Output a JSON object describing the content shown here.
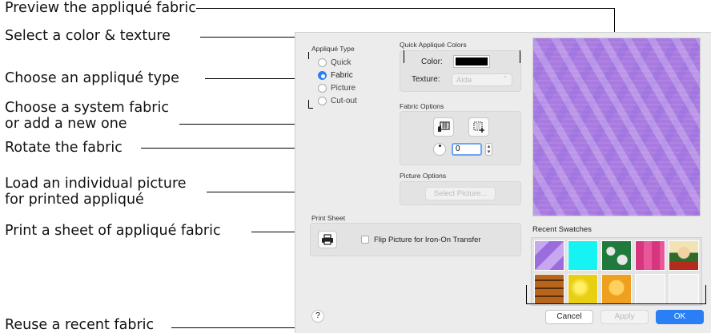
{
  "callouts": [
    "Preview the appliqué fabric",
    "Select a color & texture",
    "Choose an appliqué type",
    "Choose a system fabric",
    "or add a new one",
    "Rotate the fabric",
    "Load an individual picture",
    "for printed appliqué",
    "Print a sheet of appliqué fabric",
    "Reuse a recent fabric"
  ],
  "dialog": {
    "applique_type": {
      "title": "Appliqué Type",
      "options": [
        "Quick",
        "Fabric",
        "Picture",
        "Cut-out"
      ],
      "selected": "Fabric"
    },
    "quick_colors": {
      "title": "Quick Appliqué Colors",
      "color_label": "Color:",
      "color_value": "#000000",
      "texture_label": "Texture:",
      "texture_value": "Aida"
    },
    "fabric_options": {
      "title": "Fabric Options",
      "rotation_value": "0"
    },
    "picture_options": {
      "title": "Picture Options",
      "select_button": "Select Picture..."
    },
    "print_sheet": {
      "title": "Print Sheet",
      "flip_label": "Flip Picture for Iron-On Transfer",
      "flip_checked": false
    },
    "recent_swatches": {
      "title": "Recent Swatches",
      "swatches": [
        "purple-diamond",
        "cyan",
        "green-pattern",
        "pink-pattern",
        "character",
        "brown-brick",
        "yellow-texture",
        "orange-character",
        "empty",
        "empty"
      ]
    },
    "help_label": "?",
    "cancel_label": "Cancel",
    "apply_label": "Apply",
    "ok_label": "OK"
  },
  "colors": {
    "accent": "#2a7ff5",
    "preview_fabric": "#a97ae0"
  }
}
